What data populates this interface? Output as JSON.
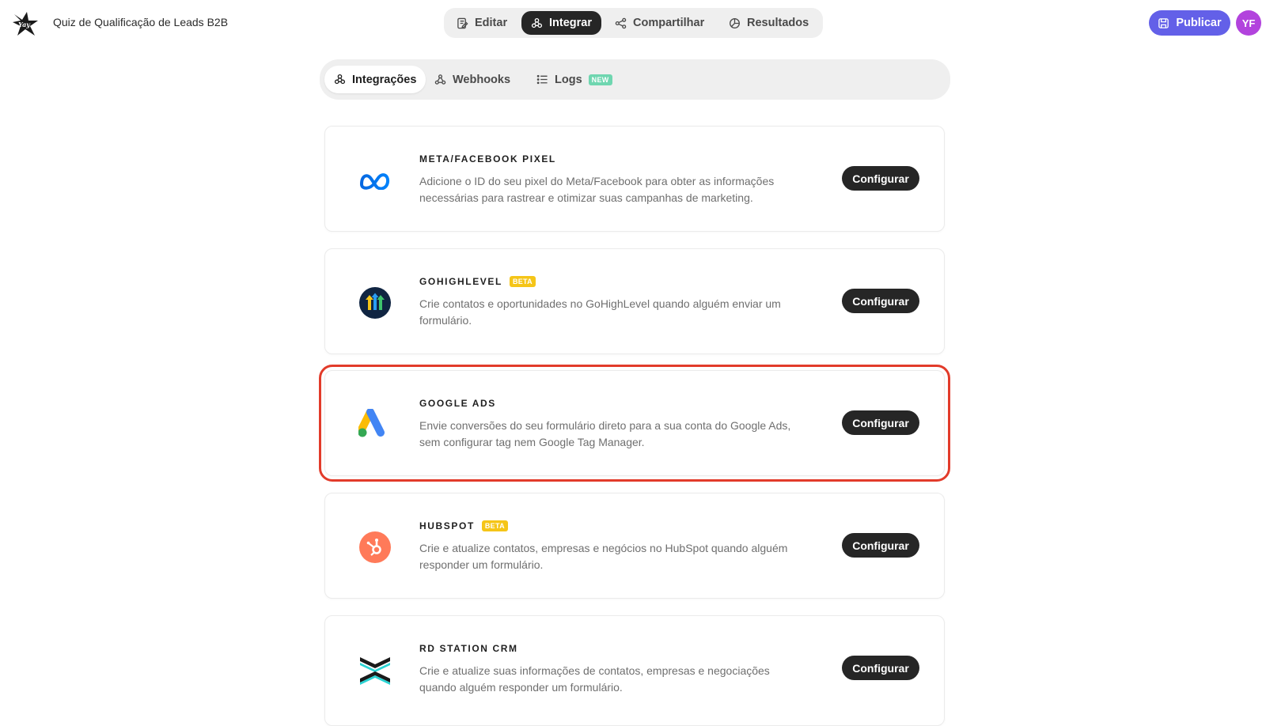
{
  "header": {
    "logo_icon": "yayforms-star-logo",
    "quiz_title": "Quiz de Qualificação de Leads B2B",
    "tabs": [
      {
        "label": "Editar",
        "icon": "edit-icon",
        "active": false
      },
      {
        "label": "Integrar",
        "icon": "integrations-icon",
        "active": true
      },
      {
        "label": "Compartilhar",
        "icon": "share-icon",
        "active": false
      },
      {
        "label": "Resultados",
        "icon": "results-icon",
        "active": false
      }
    ],
    "publish_label": "Publicar",
    "avatar_initials": "YF",
    "colors": {
      "publish": "#6360e8",
      "avatar": "#b243dd",
      "active_tab": "#262626"
    }
  },
  "sub_tabs": [
    {
      "label": "Integrações",
      "icon": "integrations-icon",
      "active": true
    },
    {
      "label": "Webhooks",
      "icon": "webhook-icon",
      "active": false
    },
    {
      "label": "Logs",
      "icon": "list-icon",
      "active": false,
      "badge": "NEW"
    }
  ],
  "integrations": [
    {
      "title": "META/FACEBOOK PIXEL",
      "icon": "meta-logo-icon",
      "description": "Adicione o ID do seu pixel do Meta/Facebook para obter as informações necessárias para rastrear e otimizar suas campanhas de marketing.",
      "button": "Configurar"
    },
    {
      "title": "GOHIGHLEVEL",
      "badge": "BETA",
      "icon": "gohighlevel-logo-icon",
      "description": "Crie contatos e oportunidades no GoHighLevel quando alguém enviar um formulário.",
      "button": "Configurar"
    },
    {
      "title": "GOOGLE ADS",
      "icon": "google-ads-logo-icon",
      "description": "Envie conversões do seu formulário direto para a sua conta do Google Ads, sem configurar tag nem Google Tag Manager.",
      "button": "Configurar",
      "highlighted": true
    },
    {
      "title": "HUBSPOT",
      "badge": "BETA",
      "icon": "hubspot-logo-icon",
      "description": "Crie e atualize contatos, empresas e negócios no HubSpot quando alguém responder um formulário.",
      "button": "Configurar"
    },
    {
      "title": "RD STATION CRM",
      "icon": "rd-station-logo-icon",
      "description": "Crie e atualize suas informações de contatos, empresas e negociações quando alguém responder um formulário.",
      "button": "Configurar"
    }
  ]
}
